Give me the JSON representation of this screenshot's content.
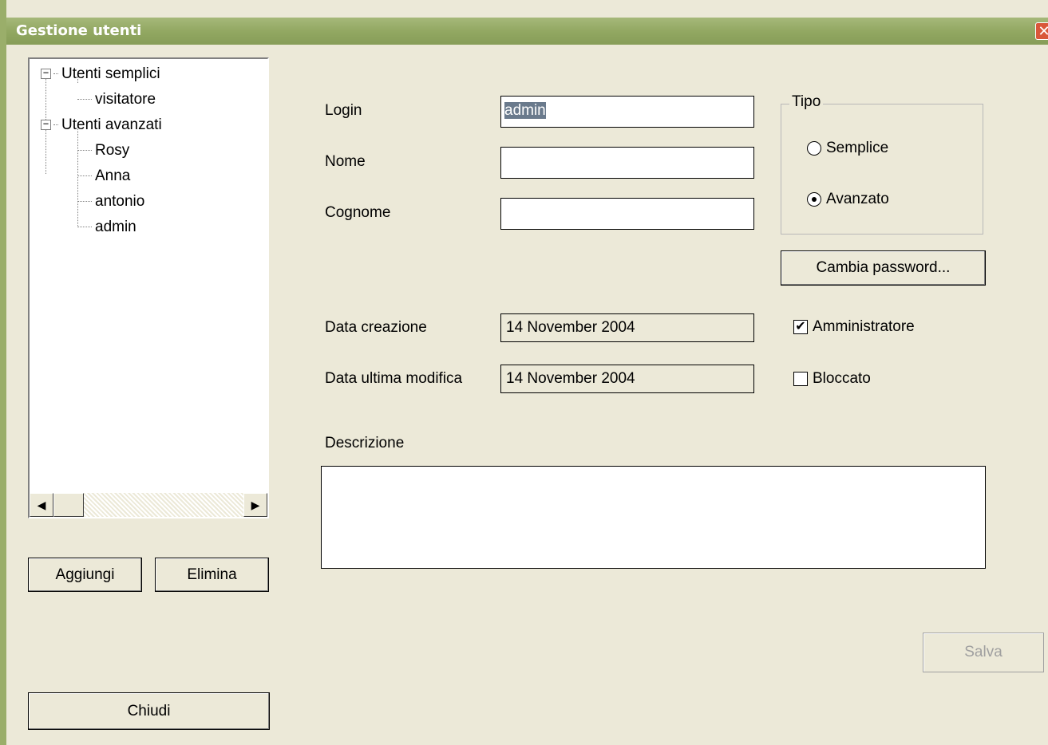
{
  "window": {
    "title": "Gestione utenti",
    "close_glyph": "✕"
  },
  "tree": {
    "groups": [
      {
        "label": "Utenti semplici",
        "expander": "−",
        "children": [
          "visitatore"
        ]
      },
      {
        "label": "Utenti avanzati",
        "expander": "−",
        "children": [
          "Rosy",
          "Anna",
          "antonio",
          "admin"
        ]
      }
    ],
    "scroll_left": "◀",
    "scroll_right": "▶"
  },
  "buttons": {
    "add": "Aggiungi",
    "delete": "Elimina",
    "close": "Chiudi",
    "change_password": "Cambia password...",
    "save": "Salva"
  },
  "form": {
    "login_label": "Login",
    "login_value": "admin",
    "name_label": "Nome",
    "name_value": "",
    "surname_label": "Cognome",
    "surname_value": "",
    "created_label": "Data creazione",
    "created_value": "14 November 2004",
    "modified_label": "Data ultima modifica",
    "modified_value": "14 November 2004",
    "description_label": "Descrizione",
    "description_value": ""
  },
  "type_group": {
    "title": "Tipo",
    "options": [
      {
        "label": "Semplice",
        "selected": false
      },
      {
        "label": "Avanzato",
        "selected": true
      }
    ]
  },
  "checks": {
    "admin_label": "Amministratore",
    "admin_checked": true,
    "blocked_label": "Bloccato",
    "blocked_checked": false
  },
  "colors": {
    "titlebar": "#92a862",
    "dialog": "#ece9d8",
    "selection": "#6a7a8c"
  }
}
